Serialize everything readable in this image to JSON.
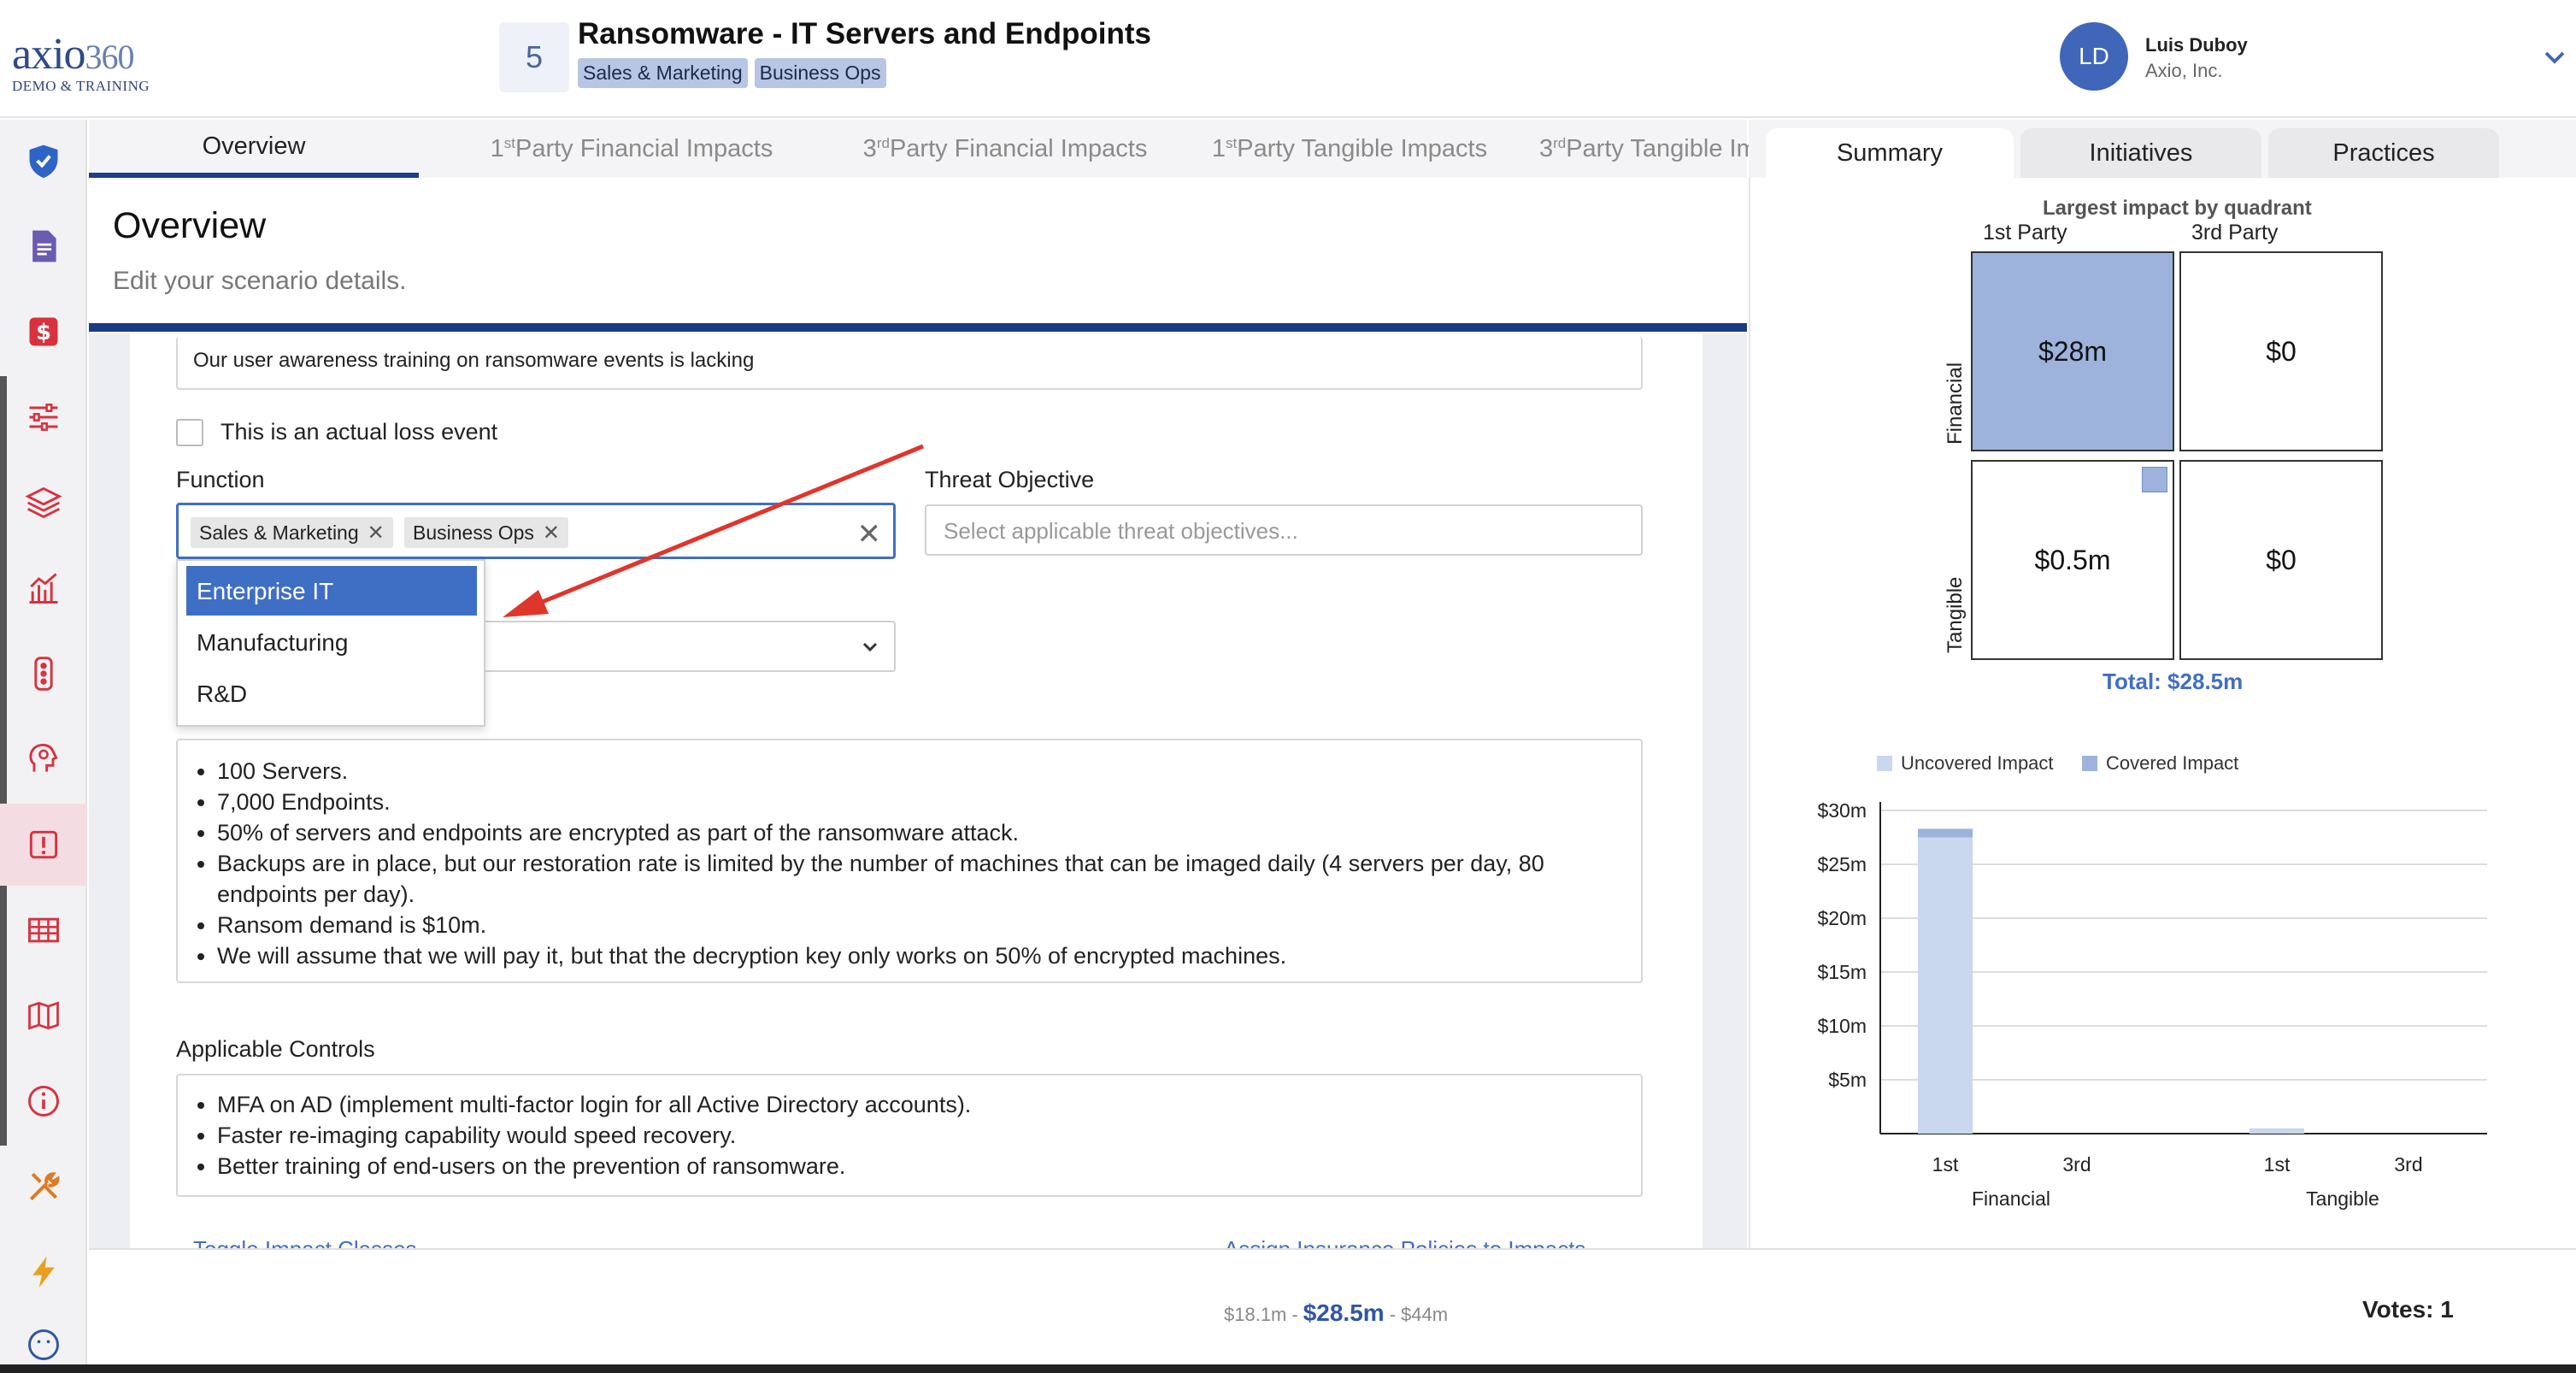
{
  "header": {
    "logo_main": "axio",
    "logo_num": "360",
    "logo_sub": "DEMO & TRAINING",
    "scenario_number": "5",
    "scenario_title": "Ransomware - IT Servers and Endpoints",
    "tags": [
      "Sales & Marketing",
      "Business Ops"
    ],
    "user_initials": "LD",
    "user_name": "Luis Duboy",
    "user_org": "Axio, Inc."
  },
  "sidebar": {
    "items": [
      {
        "icon": "shield-check-icon"
      },
      {
        "icon": "document-icon"
      },
      {
        "icon": "dollar-icon"
      },
      {
        "icon": "sliders-icon"
      },
      {
        "icon": "layers-icon"
      },
      {
        "icon": "chart-icon"
      },
      {
        "icon": "traffic-light-icon"
      },
      {
        "icon": "head-icon"
      },
      {
        "icon": "alert-icon"
      },
      {
        "icon": "table-icon"
      },
      {
        "icon": "map-icon"
      },
      {
        "icon": "info-icon"
      },
      {
        "icon": "tools-icon"
      },
      {
        "icon": "lightning-icon"
      },
      {
        "icon": "smiley-icon"
      }
    ]
  },
  "tabs": {
    "overview": "Overview",
    "t1_pre": "1",
    "t1_sup": "st",
    "t1_post": " Party Financial Impacts",
    "t2_pre": "3",
    "t2_sup": "rd",
    "t2_post": " Party Financial Impacts",
    "t3_pre": "1",
    "t3_sup": "st",
    "t3_post": " Party Tangible Impacts",
    "t4_pre": "3",
    "t4_sup": "rd",
    "t4_post": " Party Tangible Impacts"
  },
  "overview": {
    "title": "Overview",
    "subtitle": "Edit your scenario details.",
    "description_tail": "Our user awareness training on ransomware events is lacking",
    "actual_loss_label": "This is an actual loss event",
    "function_label": "Function",
    "function_chips": [
      "Sales & Marketing",
      "Business Ops"
    ],
    "threat_label": "Threat Objective",
    "threat_placeholder": "Select applicable threat objectives...",
    "dropdown_options": [
      "Enterprise IT",
      "Manufacturing",
      "R&D"
    ],
    "assumptions": [
      "100 Servers.",
      "7,000 Endpoints.",
      "50% of servers and endpoints are encrypted as part of the ransomware attack.",
      "Backups are in place, but our restoration rate is limited by the number of machines that can be imaged daily (4 servers per day, 80 endpoints per day).",
      "Ransom demand is $10m.",
      " We will assume that we will pay it, but that the decryption key only works on 50% of encrypted machines."
    ],
    "controls_label": "Applicable Controls",
    "controls": [
      "MFA on AD (implement multi-factor login for all Active Directory accounts).",
      "Faster re-imaging capability would speed recovery.",
      "Better training of end-users on the prevention of ransomware."
    ],
    "toggle_link": "Toggle Impact Classes",
    "insurance_link": "Assign Insurance Policies to Impacts"
  },
  "right_panel": {
    "tabs": [
      "Summary",
      "Initiatives",
      "Practices"
    ],
    "quad_title": "Largest impact by quadrant",
    "col_labels": [
      "1st Party",
      "3rd Party"
    ],
    "row_labels": [
      "Financial",
      "Tangible"
    ],
    "quad_values": [
      "$28m",
      "$0",
      "$0.5m",
      "$0"
    ],
    "total": "Total: $28.5m",
    "legend": {
      "uncovered": "Uncovered Impact",
      "covered": "Covered Impact"
    },
    "colors": {
      "uncovered": "#c9d7ef",
      "covered": "#9db3dc"
    }
  },
  "chart_data": {
    "type": "bar",
    "categories": [
      "1st",
      "3rd",
      "1st",
      "3rd"
    ],
    "groups": [
      "Financial",
      "Tangible"
    ],
    "series": [
      {
        "name": "Uncovered Impact",
        "values": [
          27.5,
          0,
          0.5,
          0
        ]
      },
      {
        "name": "Covered Impact",
        "values": [
          0.8,
          0,
          0,
          0
        ]
      }
    ],
    "y_ticks": [
      "$5m",
      "$10m",
      "$15m",
      "$20m",
      "$25m",
      "$30m"
    ],
    "ylim": [
      0,
      30
    ],
    "grid": true
  },
  "footer": {
    "low": "$18.1m",
    "mid": "$28.5m",
    "high": "$44m",
    "sep1": "-",
    "sep2": "-",
    "votes": "Votes: 1"
  }
}
